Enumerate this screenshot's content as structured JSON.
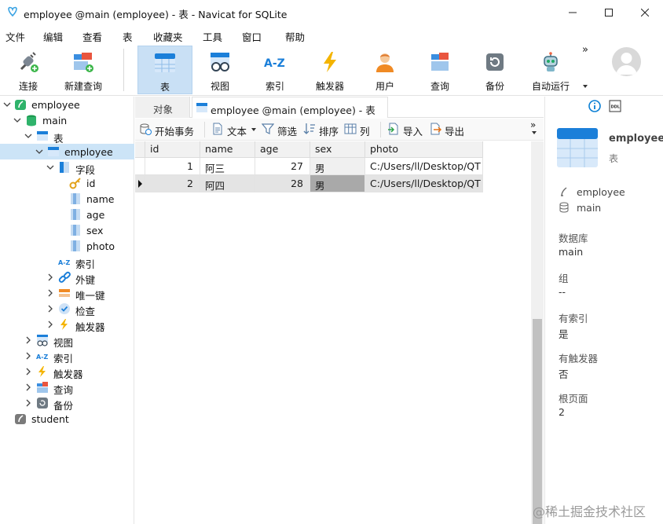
{
  "window": {
    "title": "employee @main (employee) - 表 - Navicat for SQLite"
  },
  "menu": [
    "文件",
    "编辑",
    "查看",
    "表",
    "收藏夹",
    "工具",
    "窗口",
    "帮助"
  ],
  "toolbar": {
    "connect": "连接",
    "new_query": "新建查询",
    "table": "表",
    "view": "视图",
    "index": "索引",
    "trigger": "触发器",
    "user": "用户",
    "query": "查询",
    "backup": "备份",
    "auto_run": "自动运行",
    "overflow": "»"
  },
  "sidebar": {
    "employee": "employee",
    "main": "main",
    "tables": "表",
    "employee_table": "employee",
    "fields": "字段",
    "field_list": [
      "id",
      "name",
      "age",
      "sex",
      "photo"
    ],
    "indexes": "索引",
    "foreign_keys": "外键",
    "unique_keys": "唯一键",
    "checks": "检查",
    "triggers_sub": "触发器",
    "views": "视图",
    "indexes_db": "索引",
    "triggers_db": "触发器",
    "queries": "查询",
    "backups": "备份",
    "student": "student"
  },
  "tabs": {
    "objects": "对象",
    "current": "employee @main (employee) - 表"
  },
  "subtoolbar": {
    "begin_tx": "开始事务",
    "text": "文本",
    "filter": "筛选",
    "sort": "排序",
    "columns": "列",
    "import": "导入",
    "export": "导出",
    "overflow": "»"
  },
  "grid": {
    "columns": [
      "id",
      "name",
      "age",
      "sex",
      "photo"
    ],
    "rows": [
      [
        "1",
        "阿三",
        "27",
        "男",
        "C:/Users/ll/Desktop/QT"
      ],
      [
        "2",
        "阿四",
        "28",
        "男",
        "C:/Users/ll/Desktop/QT"
      ]
    ]
  },
  "info": {
    "name": "employee",
    "type": "表",
    "connection": "employee",
    "database_small": "main",
    "db_label": "数据库",
    "db_value": "main",
    "group_label": "组",
    "group_value": "--",
    "has_index_label": "有索引",
    "has_index_value": "是",
    "has_trigger_label": "有触发器",
    "has_trigger_value": "否",
    "root_page_label": "根页面",
    "root_page_value": "2"
  },
  "watermark": "@稀土掘金技术社区",
  "colors": {
    "accent": "#0a7fd4",
    "selection": "#cce4f7",
    "toolbar_active": "#c9e0f5"
  }
}
